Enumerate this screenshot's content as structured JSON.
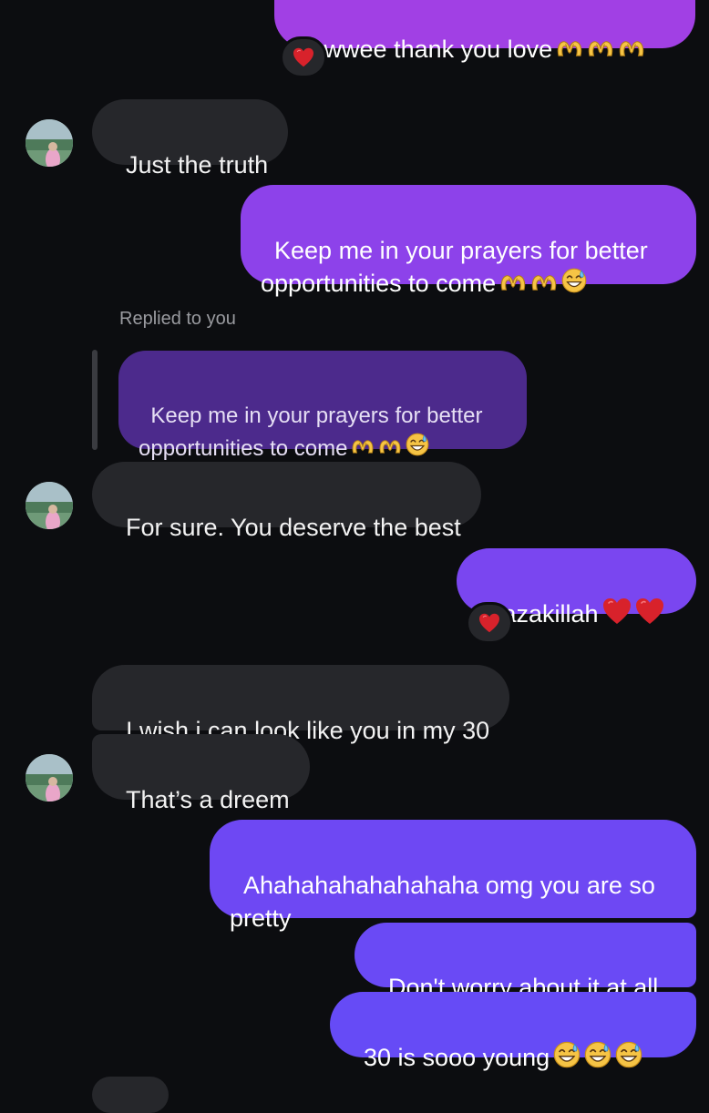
{
  "conversation": {
    "reply_label": "Replied to you",
    "messages": [
      {
        "id": "m1",
        "from": "me",
        "text": "Awwee thank you love",
        "emojis": [
          "heart-hands",
          "heart-hands",
          "heart-hands"
        ],
        "reaction": "red-heart"
      },
      {
        "id": "m2",
        "from": "them",
        "text": "Just the truth"
      },
      {
        "id": "m3",
        "from": "me",
        "text": "Keep me in your prayers for better\nopportunities to come",
        "emojis": [
          "heart-hands",
          "heart-hands",
          "sweat-smile"
        ]
      },
      {
        "id": "m4",
        "from": "quote",
        "text": "Keep me in your prayers for better\nopportunities to come",
        "emojis": [
          "heart-hands",
          "heart-hands",
          "sweat-smile"
        ]
      },
      {
        "id": "m5",
        "from": "them",
        "text": "For sure. You deserve the best"
      },
      {
        "id": "m6",
        "from": "me",
        "text": "Jazakillah",
        "emojis": [
          "red-heart",
          "red-heart"
        ],
        "reaction": "red-heart"
      },
      {
        "id": "m7",
        "from": "them",
        "text": "I wish i can look like you in my 30"
      },
      {
        "id": "m8",
        "from": "them",
        "text": "That’s a dreem"
      },
      {
        "id": "m9",
        "from": "me",
        "text": "Ahahahahahahahaha omg you are so\npretty"
      },
      {
        "id": "m10",
        "from": "me",
        "text": "Don't worry about it at all"
      },
      {
        "id": "m11",
        "from": "me",
        "text": "30 is sooo young",
        "emojis": [
          "sweat-smile",
          "sweat-smile",
          "sweat-smile"
        ]
      }
    ]
  },
  "colors": {
    "background": "#0c0d10",
    "received_bubble": "#26272b",
    "sent_gradient_top": "#9b45e6",
    "sent_gradient_bottom": "#6a4cf6",
    "quote_bubble": "#512a8e",
    "heart": "#d8222b",
    "emoji_yellow": "#f6c445"
  },
  "icons": {
    "reaction": "red-heart-icon",
    "heart_hands": "heart-hands-icon",
    "sweat_smile": "sweat-smile-icon",
    "avatar": "contact-avatar"
  }
}
